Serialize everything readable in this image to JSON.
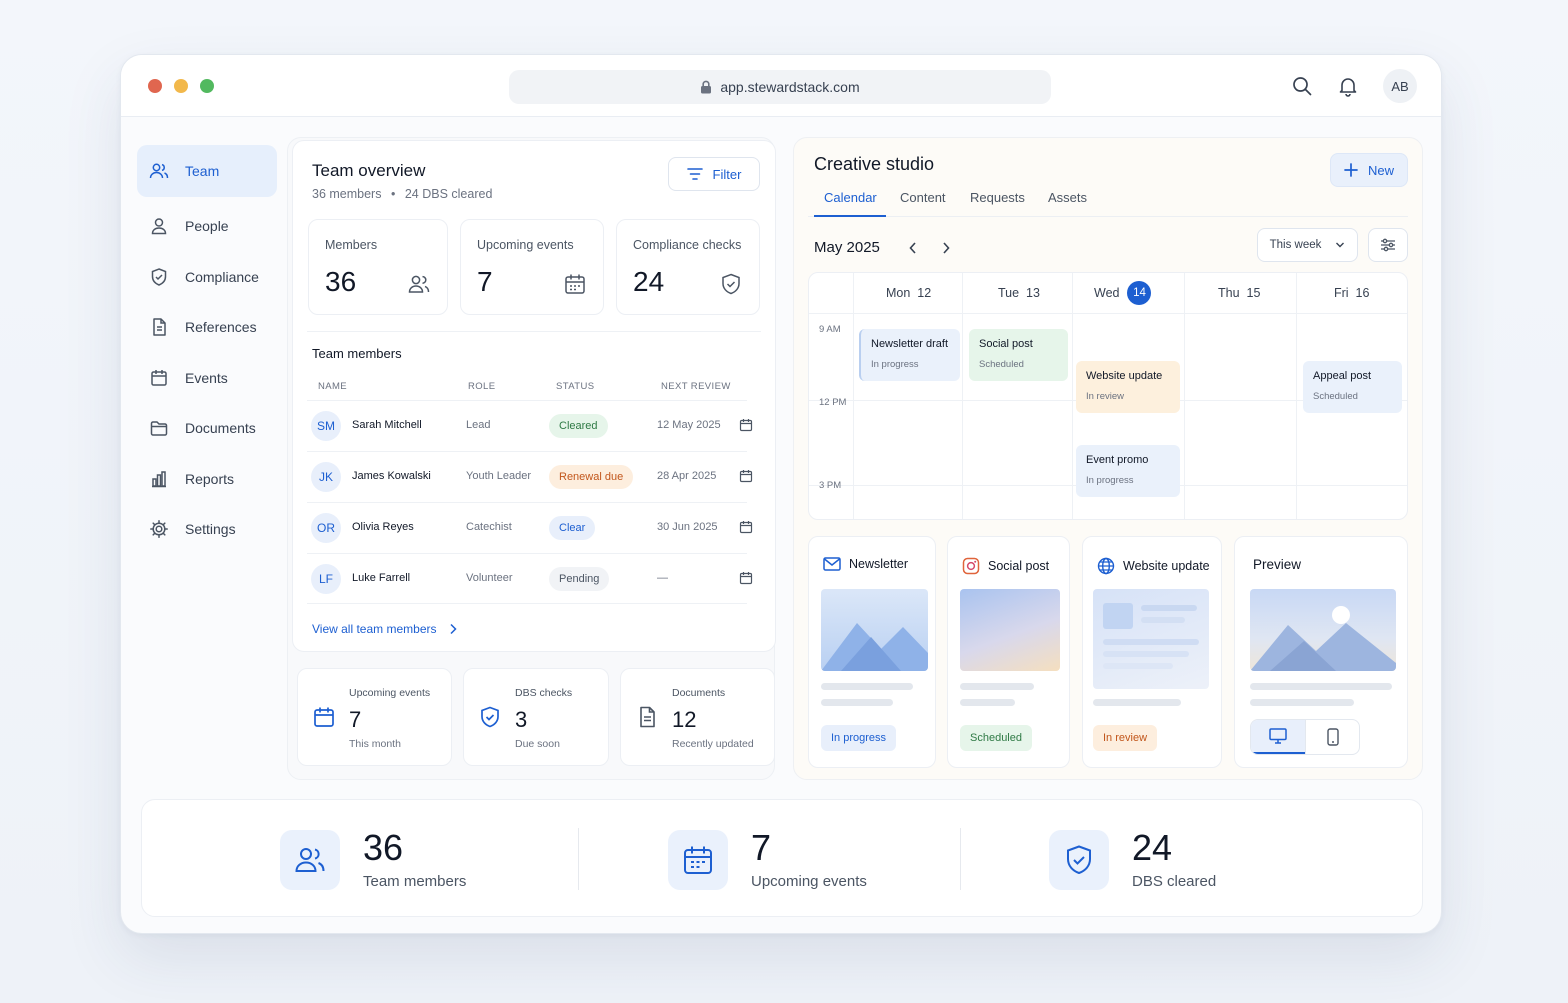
{
  "browser": {
    "url": "app.stewardstack.com",
    "avatar_initials": "AB"
  },
  "sidebar": {
    "items": [
      {
        "label": "Team",
        "icon": "users-icon",
        "active": true
      },
      {
        "label": "People",
        "icon": "user-icon"
      },
      {
        "label": "Compliance",
        "icon": "shield-icon"
      },
      {
        "label": "References",
        "icon": "document-icon"
      },
      {
        "label": "Events",
        "icon": "calendar-icon"
      },
      {
        "label": "Documents",
        "icon": "folder-icon"
      },
      {
        "label": "Reports",
        "icon": "bar-chart-icon"
      },
      {
        "label": "Settings",
        "icon": "gear-icon"
      }
    ]
  },
  "team_overview": {
    "title": "Team overview",
    "members_count": "36 members",
    "separator": "•",
    "dbs_count": "24 DBS cleared",
    "filter_label": "Filter",
    "stats": [
      {
        "label": "Members",
        "value": "36",
        "icon": "users-icon"
      },
      {
        "label": "Upcoming events",
        "value": "7",
        "icon": "calendar-icon"
      },
      {
        "label": "Compliance checks",
        "value": "24",
        "icon": "shield-check-icon"
      }
    ],
    "members_title": "Team members",
    "columns": [
      "NAME",
      "ROLE",
      "STATUS",
      "NEXT REVIEW"
    ],
    "rows": [
      {
        "initials": "SM",
        "name": "Sarah Mitchell",
        "role": "Lead",
        "status": "Cleared",
        "review": "12 May 2025"
      },
      {
        "initials": "JK",
        "name": "James Kowalski",
        "role": "Youth Leader",
        "status": "Renewal due",
        "review": "28 Apr 2025"
      },
      {
        "initials": "OR",
        "name": "Olivia Reyes",
        "role": "Catechist",
        "status": "Clear",
        "review": "30 Jun 2025"
      },
      {
        "initials": "LF",
        "name": "Luke Farrell",
        "role": "Volunteer",
        "status": "Pending",
        "review": "—"
      }
    ],
    "view_all": "View all team members"
  },
  "mini_stats": [
    {
      "label": "Upcoming events",
      "value": "7",
      "sub": "This month",
      "icon": "calendar-icon"
    },
    {
      "label": "DBS checks",
      "value": "3",
      "sub": "Due soon",
      "icon": "shield-check-icon"
    },
    {
      "label": "Documents",
      "value": "12",
      "sub": "Recently updated",
      "icon": "document-icon"
    }
  ],
  "studio": {
    "title": "Creative studio",
    "new_label": "New",
    "tabs": [
      "Calendar",
      "Content",
      "Requests",
      "Assets"
    ],
    "month": "May 2025",
    "range": "This week",
    "days": [
      {
        "name": "Mon",
        "num": "12"
      },
      {
        "name": "Tue",
        "num": "13"
      },
      {
        "name": "Wed",
        "num": "14",
        "today": true
      },
      {
        "name": "Thu",
        "num": "15"
      },
      {
        "name": "Fri",
        "num": "16"
      }
    ],
    "times": [
      "9 AM",
      "12 PM",
      "3 PM"
    ],
    "events": [
      {
        "title": "Newsletter draft",
        "status": "In progress",
        "day": "Mon"
      },
      {
        "title": "Social post",
        "status": "Scheduled",
        "day": "Tue"
      },
      {
        "title": "Website update",
        "status": "In review",
        "day": "Wed"
      },
      {
        "title": "Event promo",
        "status": "In progress",
        "day": "Wed"
      },
      {
        "title": "Appeal post",
        "status": "Scheduled",
        "day": "Fri"
      }
    ],
    "cards": [
      {
        "title": "Newsletter",
        "status": "In progress",
        "icon": "mail-icon"
      },
      {
        "title": "Social post",
        "status": "Scheduled",
        "icon": "instagram-icon"
      },
      {
        "title": "Website update",
        "status": "In review",
        "icon": "globe-icon"
      },
      {
        "title": "Preview",
        "icon": ""
      }
    ]
  },
  "summary": [
    {
      "value": "36",
      "label": "Team members",
      "icon": "users-icon"
    },
    {
      "value": "7",
      "label": "Upcoming events",
      "icon": "calendar-icon"
    },
    {
      "value": "24",
      "label": "DBS cleared",
      "icon": "shield-check-icon"
    }
  ],
  "colors": {
    "accent": "#1d5fd1",
    "accent_light": "#e6effc",
    "success": "#e6f5ea",
    "warning": "#fdeede"
  }
}
